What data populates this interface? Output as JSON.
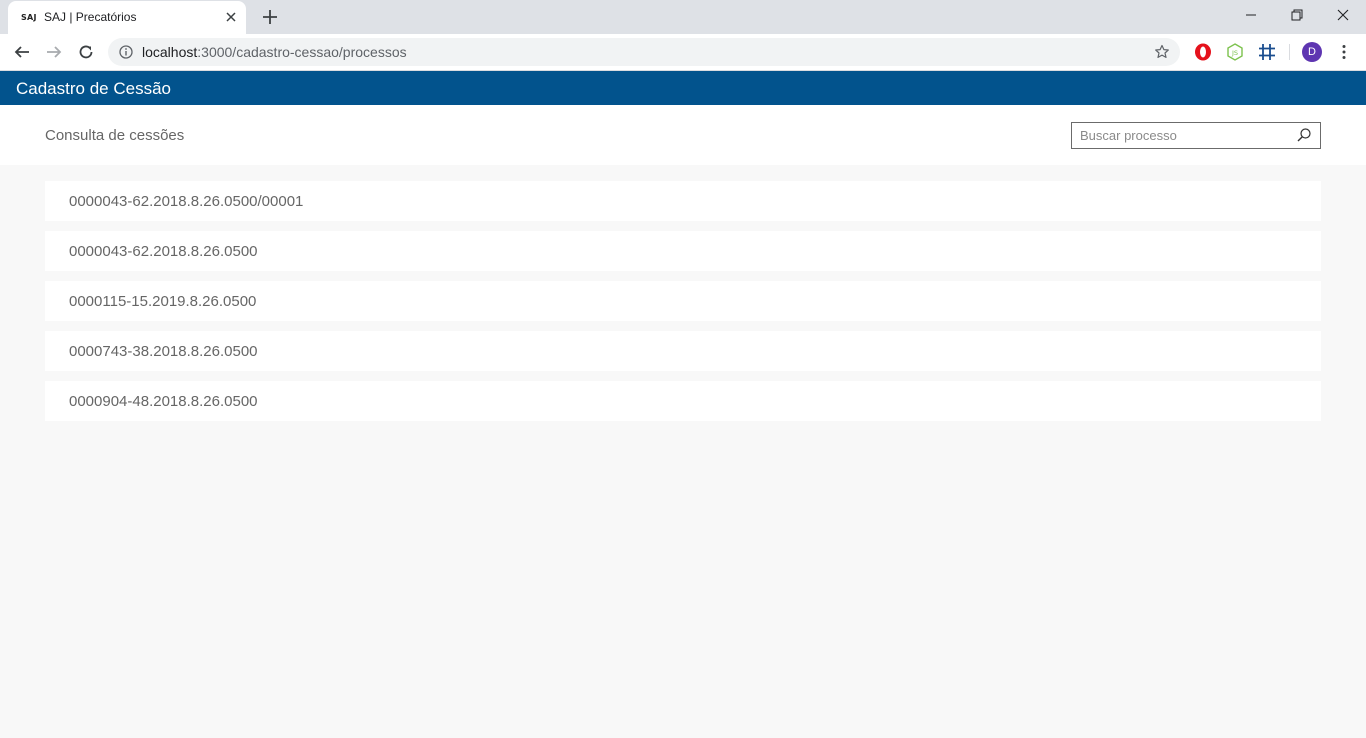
{
  "browser": {
    "tab": {
      "favicon_text": "SAJ",
      "title": "SAJ | Precatórios"
    },
    "address": {
      "host": "localhost",
      "rest": ":3000/cadastro-cessao/processos"
    },
    "profile_initial": "D",
    "icons": [
      "back-icon",
      "forward-icon",
      "reload-icon",
      "info-icon",
      "star-icon",
      "opera-icon",
      "nodejs-icon",
      "grid-icon",
      "menu-kebab-icon"
    ]
  },
  "header": {
    "title": "Cadastro de Cessão"
  },
  "page": {
    "title": "Consulta de cessões",
    "search": {
      "placeholder": "Buscar processo",
      "value": ""
    }
  },
  "processos": [
    "0000043-62.2018.8.26.0500/00001",
    "0000043-62.2018.8.26.0500",
    "0000115-15.2019.8.26.0500",
    "0000743-38.2018.8.26.0500",
    "0000904-48.2018.8.26.0500"
  ],
  "colors": {
    "header_bg": "#02538d",
    "page_bg": "#f8f8f8",
    "text_muted": "#666666"
  }
}
